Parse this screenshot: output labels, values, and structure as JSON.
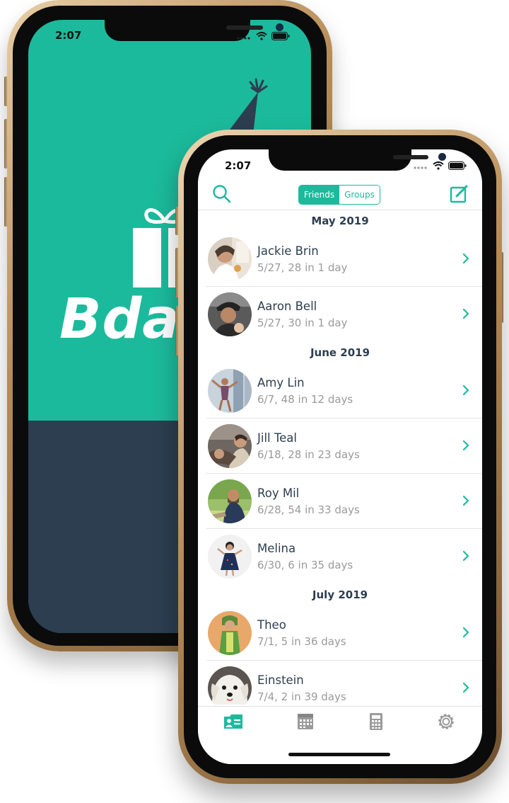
{
  "colors": {
    "accent": "#1cba9c",
    "dark": "#2c3e50",
    "subtle": "#9a9a9a"
  },
  "back_phone": {
    "time": "2:07",
    "app_name": "Bday"
  },
  "front_phone": {
    "status": {
      "time": "2:07"
    },
    "nav": {
      "segments": [
        {
          "label": "Friends",
          "selected": true
        },
        {
          "label": "Groups",
          "selected": false
        }
      ],
      "icons": [
        "search-icon",
        "compose-icon"
      ]
    },
    "sections": [
      {
        "title": "May 2019",
        "items": [
          {
            "name": "Jackie Brin",
            "detail": "5/27, 28 in 1 day"
          },
          {
            "name": "Aaron Bell",
            "detail": "5/27, 30 in 1 day"
          }
        ]
      },
      {
        "title": "June 2019",
        "items": [
          {
            "name": "Amy Lin",
            "detail": "6/7, 48 in 12 days"
          },
          {
            "name": "Jill Teal",
            "detail": "6/18, 28 in 23 days"
          },
          {
            "name": "Roy Mil",
            "detail": "6/28, 54 in 33 days"
          },
          {
            "name": "Melina",
            "detail": "6/30, 6 in 35 days"
          }
        ]
      },
      {
        "title": "July 2019",
        "items": [
          {
            "name": "Theo",
            "detail": "7/1, 5 in 36 days"
          },
          {
            "name": "Einstein",
            "detail": "7/4, 2 in 39 days"
          }
        ]
      }
    ],
    "tabs": [
      {
        "icon": "contacts-icon",
        "selected": true
      },
      {
        "icon": "calendar-icon",
        "selected": false
      },
      {
        "icon": "calculator-icon",
        "selected": false
      },
      {
        "icon": "settings-gear-icon",
        "selected": false
      }
    ]
  }
}
